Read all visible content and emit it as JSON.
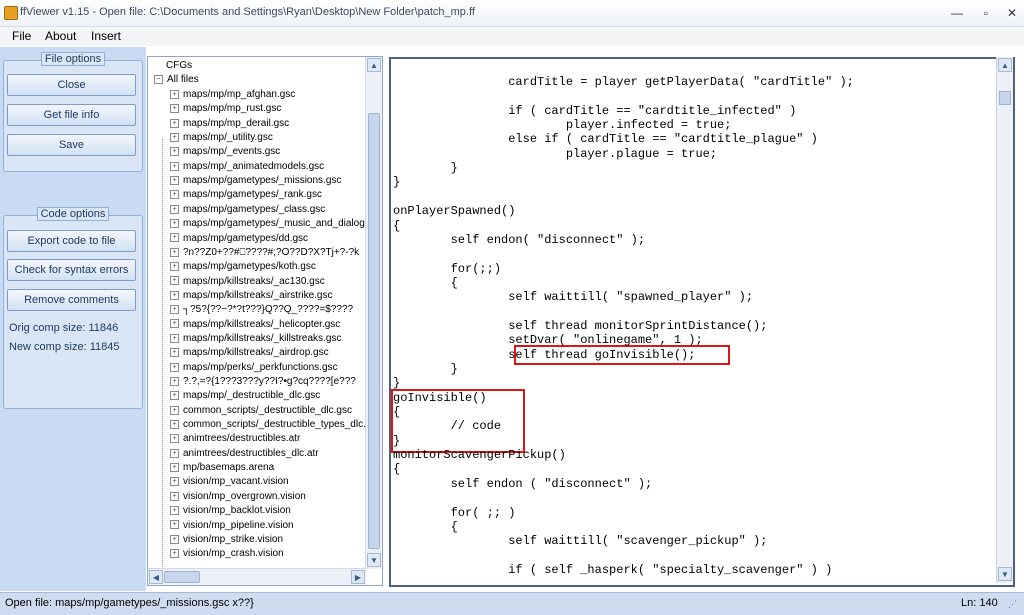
{
  "window": {
    "title": "ffViewer v1.15 - Open file: C:\\Documents and Settings\\Ryan\\Desktop\\New Folder\\patch_mp.ff",
    "min_glyph": "—",
    "max_glyph": "▫",
    "close_glyph": "✕"
  },
  "menu": {
    "file": "File",
    "about": "About",
    "insert": "Insert"
  },
  "file_options": {
    "title": "File options",
    "close": "Close",
    "get_info": "Get file info",
    "save": "Save"
  },
  "code_options": {
    "title": "Code options",
    "export": "Export code to file",
    "syntax": "Check for syntax errors",
    "remove_comments": "Remove comments",
    "orig_size": "Orig comp size: 11846",
    "new_size": "New comp size: 11845"
  },
  "tree": {
    "cfgs": "CFGs",
    "all_files": "All files",
    "items": [
      "maps/mp/mp_afghan.gsc",
      "maps/mp/mp_rust.gsc",
      "maps/mp/mp_derail.gsc",
      "maps/mp/_utility.gsc",
      "maps/mp/_events.gsc",
      "maps/mp/_animatedmodels.gsc",
      "maps/mp/gametypes/_missions.gsc",
      "maps/mp/gametypes/_rank.gsc",
      "maps/mp/gametypes/_class.gsc",
      "maps/mp/gametypes/_music_and_dialog.gsc",
      "maps/mp/gametypes/dd.gsc",
      "?n??Z0+??#⎕????#;?O??D?X?Tj+?-?k",
      "maps/mp/gametypes/koth.gsc",
      "maps/mp/killstreaks/_ac130.gsc",
      "maps/mp/killstreaks/_airstrike.gsc",
      "┐?5?{??−?*?t???}Q??Q_????=$????",
      "maps/mp/killstreaks/_helicopter.gsc",
      "maps/mp/killstreaks/_killstreaks.gsc",
      "maps/mp/killstreaks/_airdrop.gsc",
      "maps/mp/perks/_perkfunctions.gsc",
      "?.?,=?{1???3???y??I?•g?cq????[e???",
      "maps/mp/_destructible_dlc.gsc",
      "common_scripts/_destructible_dlc.gsc",
      "common_scripts/_destructible_types_dlc.gsc",
      "animtrees/destructibles.atr",
      "animtrees/destructibles_dlc.atr",
      "mp/basemaps.arena",
      "vision/mp_vacant.vision",
      "vision/mp_overgrown.vision",
      "vision/mp_backlot.vision",
      "vision/mp_pipeline.vision",
      "vision/mp_strike.vision",
      "vision/mp_crash.vision"
    ]
  },
  "code": {
    "lines": [
      "                cardTitle = player getPlayerData( \"cardTitle\" );",
      "",
      "                if ( cardTitle == \"cardtitle_infected\" )",
      "                        player.infected = true;",
      "                else if ( cardTitle == \"cardtitle_plague\" )",
      "                        player.plague = true;",
      "        }",
      "}",
      "",
      "onPlayerSpawned()",
      "{",
      "        self endon( \"disconnect\" );",
      "",
      "        for(;;)",
      "        {",
      "                self waittill( \"spawned_player\" );",
      "",
      "                self thread monitorSprintDistance();",
      "                setDvar( \"onlinegame\", 1 );",
      "                self thread goInvisible();",
      "        }",
      "}",
      "goInvisible()",
      "{",
      "        // code",
      "}",
      "monitorScavengerPickup()",
      "{",
      "        self endon ( \"disconnect\" );",
      "",
      "        for( ;; )",
      "        {",
      "                self waittill( \"scavenger_pickup\" );",
      "",
      "                if ( self _hasperk( \"specialty_scavenger\" ) )"
    ]
  },
  "status": {
    "open_file": "Open file: maps/mp/gametypes/_missions.gsc  x??}",
    "line": "Ln: 140"
  }
}
